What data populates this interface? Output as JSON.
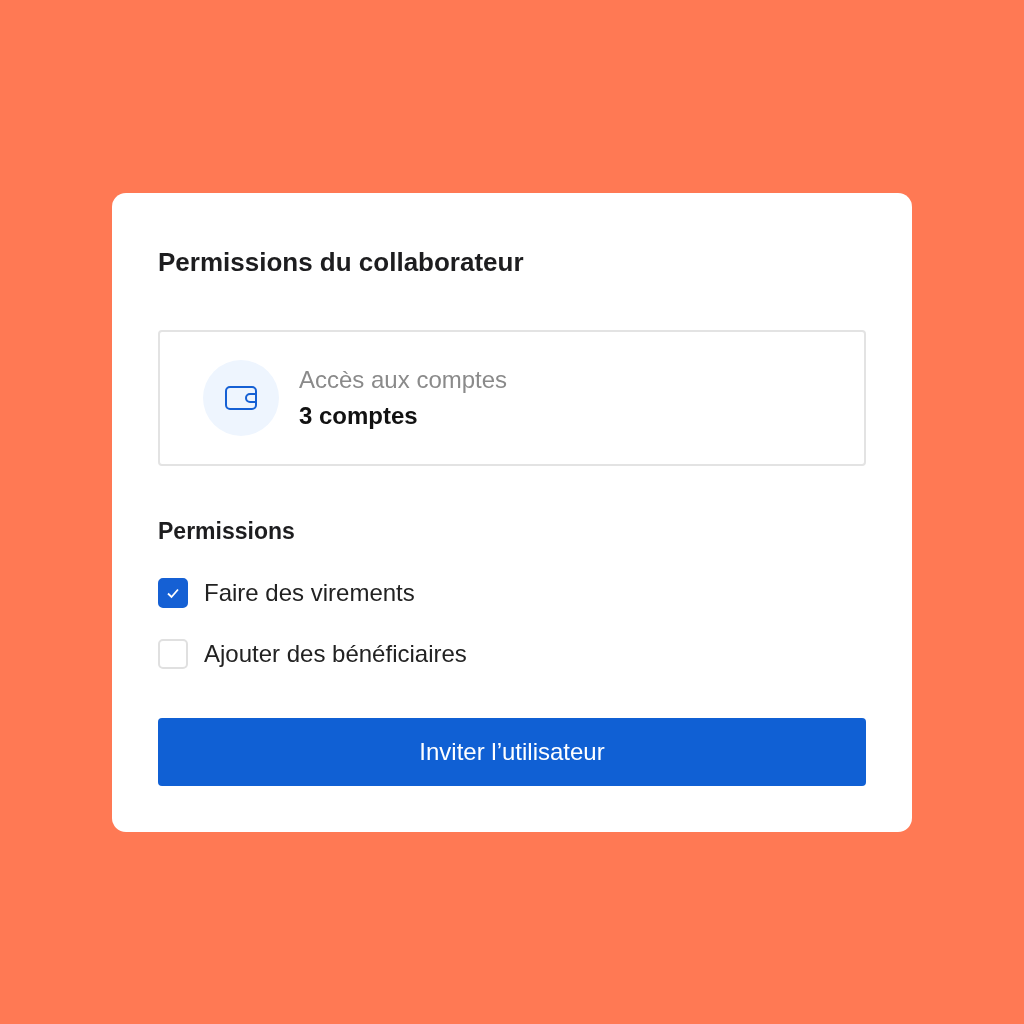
{
  "card": {
    "title": "Permissions du collaborateur",
    "access": {
      "label": "Accès aux comptes",
      "value": "3 comptes"
    },
    "permissions_heading": "Permissions",
    "permissions": [
      {
        "label": "Faire des virements",
        "checked": true
      },
      {
        "label": "Ajouter des bénéficiaires",
        "checked": false
      }
    ],
    "button": "Inviter l’utilisateur"
  }
}
